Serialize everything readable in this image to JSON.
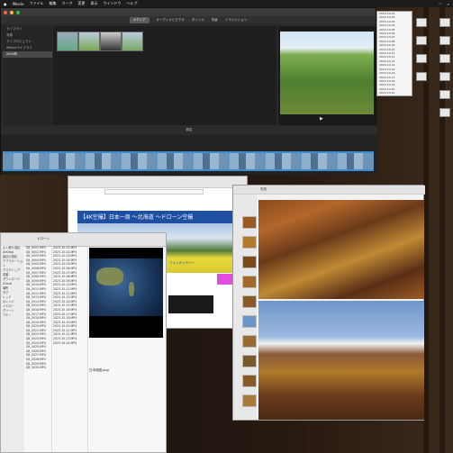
{
  "menubar": {
    "app_name": "iMovie",
    "items": [
      "ファイル",
      "編集",
      "マーク",
      "変更",
      "表示",
      "ウインドウ",
      "ヘルプ"
    ]
  },
  "imovie": {
    "tabs": [
      "メディア",
      "オーディオとビデオ",
      "タイトル",
      "背景",
      "トランジション"
    ],
    "active_tab": "メディア",
    "sidebar_items": [
      "ライブラリ",
      "写真",
      "マイプロジェクト",
      "iMovieライブラリ",
      "2024年"
    ],
    "timeline_label": "設定"
  },
  "web": {
    "banner_text": "【4K空撮】日本一周 ～北海道 ～ドローン空撮",
    "link_text": "フォトギャラリー"
  },
  "finder": {
    "title": "ドローン",
    "preview_title": "日本地図.png",
    "sidebar": [
      "よく使う項目",
      "AirDrop",
      "最近の項目",
      "アプリケーション",
      "デスクトップ",
      "書類",
      "ダウンロード",
      "iCloud",
      "場所",
      "タグ",
      "レッド",
      "オレンジ",
      "イエロー",
      "グリーン",
      "ブルー"
    ],
    "col1": [
      "DJI_0001.MP4",
      "DJI_0002.MP4",
      "DJI_0003.MP4",
      "DJI_0004.MP4",
      "DJI_0005.MP4",
      "DJI_0006.MP4",
      "DJI_0007.MP4",
      "DJI_0008.MP4",
      "DJI_0009.MP4",
      "DJI_0010.MP4",
      "DJI_0011.MP4",
      "DJI_0012.MP4",
      "DJI_0013.MP4",
      "DJI_0014.MP4",
      "DJI_0015.MP4",
      "DJI_0016.MP4",
      "DJI_0017.MP4",
      "DJI_0018.MP4",
      "DJI_0019.MP4",
      "DJI_0020.MP4",
      "DJI_0021.MP4",
      "DJI_0022.MP4",
      "DJI_0023.MP4",
      "DJI_0024.MP4",
      "DJI_0025.MP4",
      "DJI_0026.MP4",
      "DJI_0027.MP4",
      "DJI_0028.MP4",
      "DJI_0029.MP4",
      "DJI_0030.MP4"
    ],
    "col2": [
      "2023-10-01.MP4",
      "2023-10-02.MP4",
      "2023-10-03.MP4",
      "2023-10-04.MP4",
      "2023-10-05.MP4",
      "2023-10-06.MP4",
      "2023-10-07.MP4",
      "2023-10-08.MP4",
      "2023-10-09.MP4",
      "2023-10-10.MP4",
      "2023-10-11.MP4",
      "2023-10-12.MP4",
      "2023-10-13.MP4",
      "2023-10-14.MP4",
      "2023-10-15.MP4",
      "2023-10-16.MP4",
      "2023-10-17.MP4",
      "2023-10-18.MP4",
      "2023-10-19.MP4",
      "2023-10-20.MP4",
      "2023-10-21.MP4",
      "2023-10-22.MP4",
      "2023-10-23.MP4",
      "2023-10-24.MP4"
    ]
  },
  "photos": {
    "title": "写真"
  },
  "right_files": [
    "2023-10-01",
    "2023-10-02",
    "2023-10-03",
    "2023-10-04",
    "2023-10-05",
    "2023-10-06",
    "2023-10-07",
    "2023-10-08",
    "2023-10-09",
    "2023-10-10",
    "2023-10-11",
    "2023-10-12",
    "2023-10-13",
    "2023-10-14",
    "2023-10-15",
    "2023-10-16",
    "2023-10-17",
    "2023-10-18",
    "2023-10-19",
    "2023-10-20",
    "2023-10-21"
  ],
  "colors": {
    "accent": "#3d8ccc",
    "banner": "#1f4fa0",
    "highlight": "#e24ce0"
  }
}
